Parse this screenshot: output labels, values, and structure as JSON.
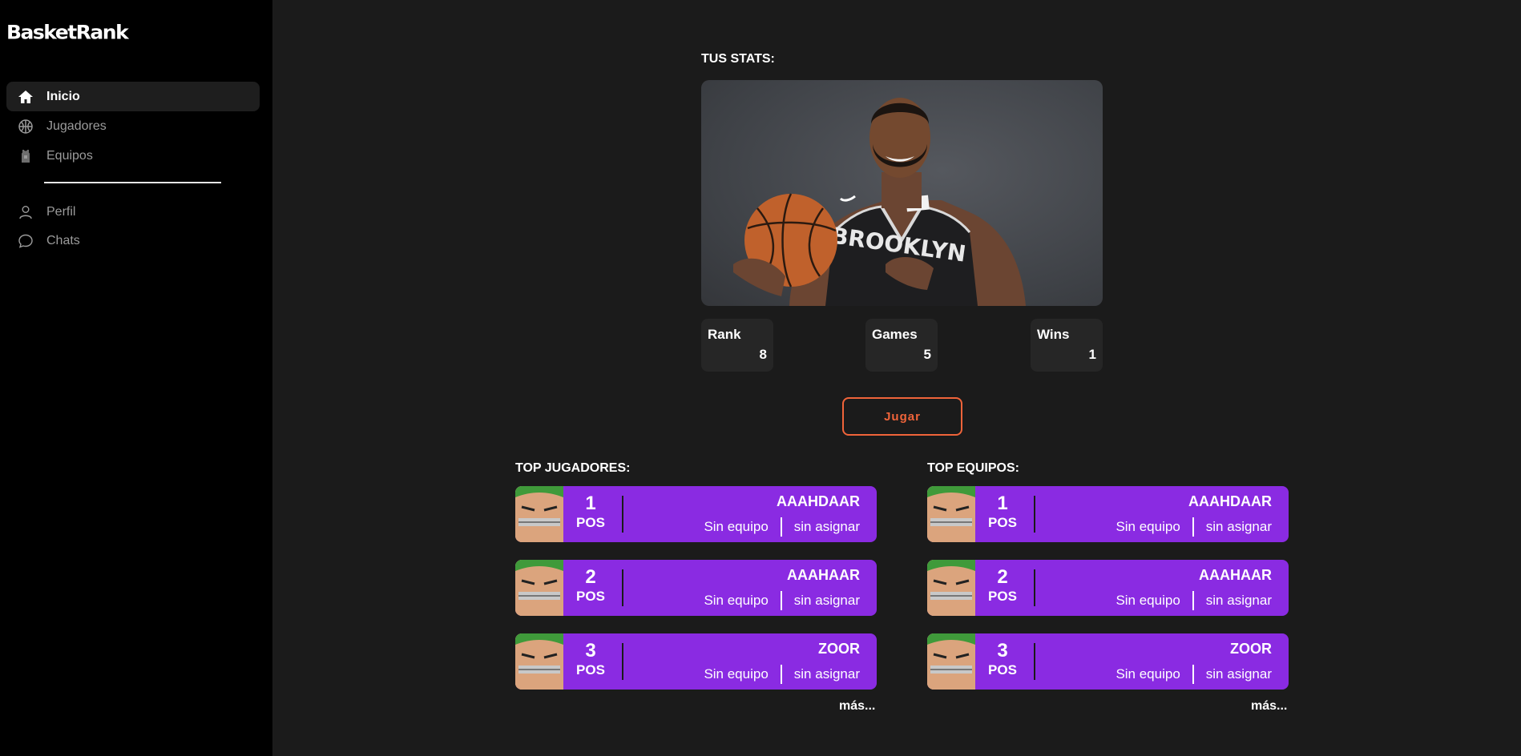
{
  "app": {
    "logo": "BasketRank"
  },
  "sidebar": {
    "items": [
      {
        "label": "Inicio",
        "icon": "home-icon",
        "active": true
      },
      {
        "label": "Jugadores",
        "icon": "basketball-icon",
        "active": false
      },
      {
        "label": "Equipos",
        "icon": "jersey-icon",
        "active": false
      }
    ],
    "secondary": [
      {
        "label": "Perfil",
        "icon": "user-icon"
      },
      {
        "label": "Chats",
        "icon": "chat-icon"
      }
    ]
  },
  "stats": {
    "title": "TUS STATS:",
    "cards": [
      {
        "label": "Rank",
        "value": "8"
      },
      {
        "label": "Games",
        "value": "5"
      },
      {
        "label": "Wins",
        "value": "1"
      }
    ],
    "play_label": "Jugar"
  },
  "top_players": {
    "title": "TOP JUGADORES:",
    "rows": [
      {
        "pos": "1",
        "pos_label": "POS",
        "name": "AAAHDAAR",
        "team": "Sin equipo",
        "role": "sin asignar"
      },
      {
        "pos": "2",
        "pos_label": "POS",
        "name": "AAAHAAR",
        "team": "Sin equipo",
        "role": "sin asignar"
      },
      {
        "pos": "3",
        "pos_label": "POS",
        "name": "ZOOR",
        "team": "Sin equipo",
        "role": "sin asignar"
      }
    ],
    "more": "más..."
  },
  "top_teams": {
    "title": "TOP EQUIPOS:",
    "rows": [
      {
        "pos": "1",
        "pos_label": "POS",
        "name": "AAAHDAAR",
        "team": "Sin equipo",
        "role": "sin asignar"
      },
      {
        "pos": "2",
        "pos_label": "POS",
        "name": "AAAHAAR",
        "team": "Sin equipo",
        "role": "sin asignar"
      },
      {
        "pos": "3",
        "pos_label": "POS",
        "name": "ZOOR",
        "team": "Sin equipo",
        "role": "sin asignar"
      }
    ],
    "more": "más..."
  },
  "colors": {
    "accent": "#f0643a",
    "card": "#8a2be2",
    "sidebar_bg": "#000000",
    "main_bg": "#1b1b1b"
  }
}
